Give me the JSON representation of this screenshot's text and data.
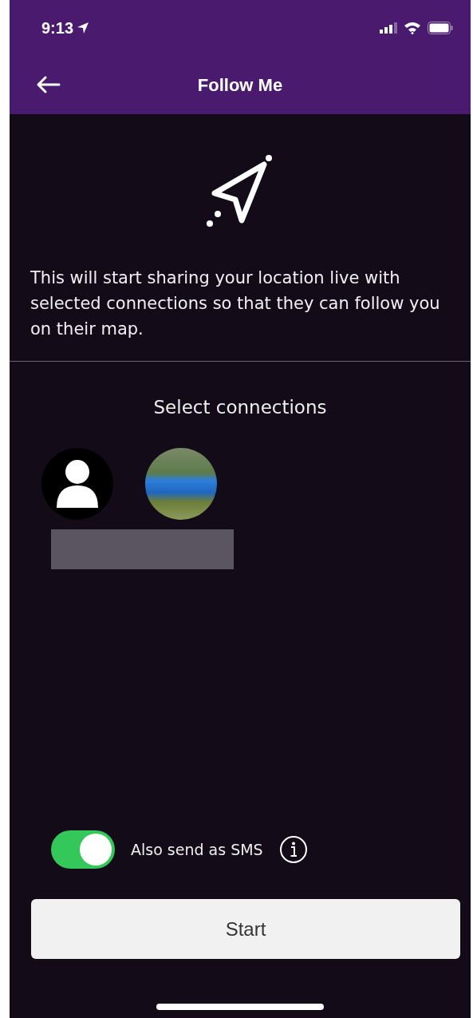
{
  "status_bar": {
    "time": "9:13",
    "location_on": true
  },
  "nav": {
    "title": "Follow Me"
  },
  "description": "This will start sharing your location live with selected connections so that they can follow you on their map.",
  "connections": {
    "title": "Select connections",
    "items": [
      {
        "kind": "placeholder"
      },
      {
        "kind": "photo"
      }
    ]
  },
  "sms_toggle": {
    "label": "Also send as SMS",
    "on": true
  },
  "start_button": {
    "label": "Start"
  }
}
